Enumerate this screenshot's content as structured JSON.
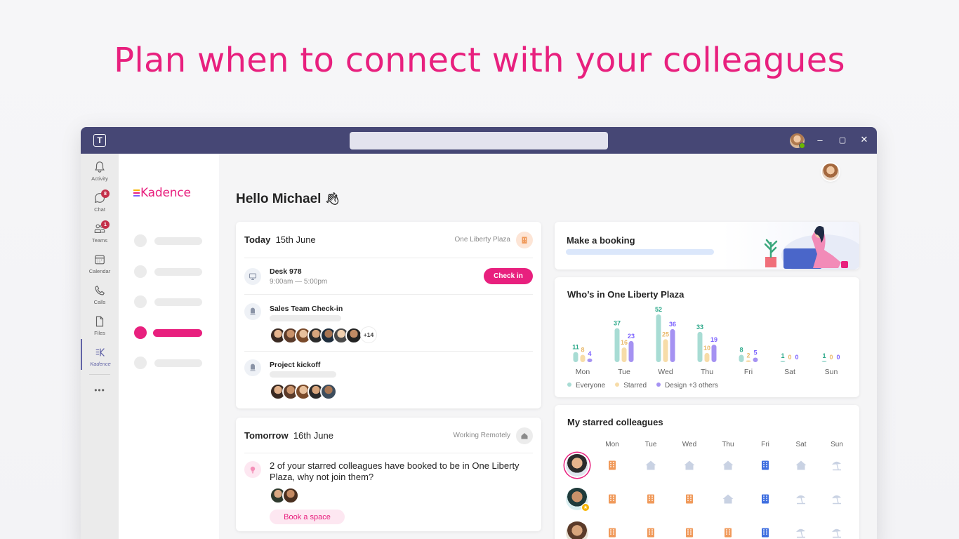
{
  "headline": "Plan when to connect with your colleagues",
  "titlebar": {
    "window_controls": [
      "–",
      "▢",
      "✕"
    ]
  },
  "rail": {
    "items": [
      {
        "label": "Activity",
        "icon": "bell-icon"
      },
      {
        "label": "Chat",
        "icon": "chat-icon",
        "badge": "8"
      },
      {
        "label": "Teams",
        "icon": "teams-icon",
        "badge": "1"
      },
      {
        "label": "Calendar",
        "icon": "calendar-icon"
      },
      {
        "label": "Calls",
        "icon": "phone-icon"
      },
      {
        "label": "Files",
        "icon": "file-icon"
      },
      {
        "label": "Kadence",
        "icon": "kadence-icon"
      }
    ],
    "more": "•••"
  },
  "sidebar": {
    "logo": "Kadence",
    "active_index": 3
  },
  "main": {
    "greeting": "Hello Michael",
    "today": {
      "day": "Today",
      "date": "15th June",
      "location": "One Liberty Plaza",
      "events": [
        {
          "title": "Desk 978",
          "time": "9:00am — 5:00pm",
          "action": "Check in"
        },
        {
          "title": "Sales Team Check-in",
          "extra": "+14"
        },
        {
          "title": "Project kickoff"
        }
      ]
    },
    "tomorrow": {
      "day": "Tomorrow",
      "date": "16th June",
      "location": "Working Remotely",
      "message": "2 of your starred colleagues have booked to be in One Liberty Plaza, why not join them?",
      "action": "Book a space"
    },
    "booking": {
      "title": "Make a booking"
    },
    "whos_in": {
      "title": "Who’s in One Liberty Plaza"
    },
    "starred": {
      "title": "My starred colleagues",
      "days": [
        "Mon",
        "Tue",
        "Wed",
        "Thu",
        "Fri",
        "Sat",
        "Sun"
      ],
      "rows": [
        [
          "office",
          "home",
          "home",
          "home",
          "office-blue",
          "home",
          "beach"
        ],
        [
          "office",
          "office",
          "office",
          "home",
          "office-blue",
          "beach",
          "beach"
        ],
        [
          "office",
          "office",
          "office",
          "office",
          "office-blue",
          "beach",
          "beach"
        ]
      ]
    }
  },
  "colors": {
    "accent": "#e8207e",
    "teams": "#464775",
    "everyone": "#a8dcd4",
    "starred": "#f7dca8",
    "design": "#a592f2"
  },
  "chart_data": {
    "type": "bar",
    "title": "Who’s in One Liberty Plaza",
    "categories": [
      "Mon",
      "Tue",
      "Wed",
      "Thu",
      "Fri",
      "Sat",
      "Sun"
    ],
    "series": [
      {
        "name": "Everyone",
        "values": [
          11,
          37,
          52,
          33,
          8,
          1,
          1
        ],
        "color": "#a8dcd4",
        "label_color": "#2aa889"
      },
      {
        "name": "Starred",
        "values": [
          8,
          16,
          25,
          10,
          2,
          0,
          0
        ],
        "color": "#f7dca8",
        "label_color": "#e9b96b"
      },
      {
        "name": "Design +3 others",
        "values": [
          4,
          23,
          36,
          19,
          5,
          0,
          0
        ],
        "color": "#a592f2",
        "label_color": "#7b61ff"
      }
    ],
    "legend": "bottom-left"
  }
}
